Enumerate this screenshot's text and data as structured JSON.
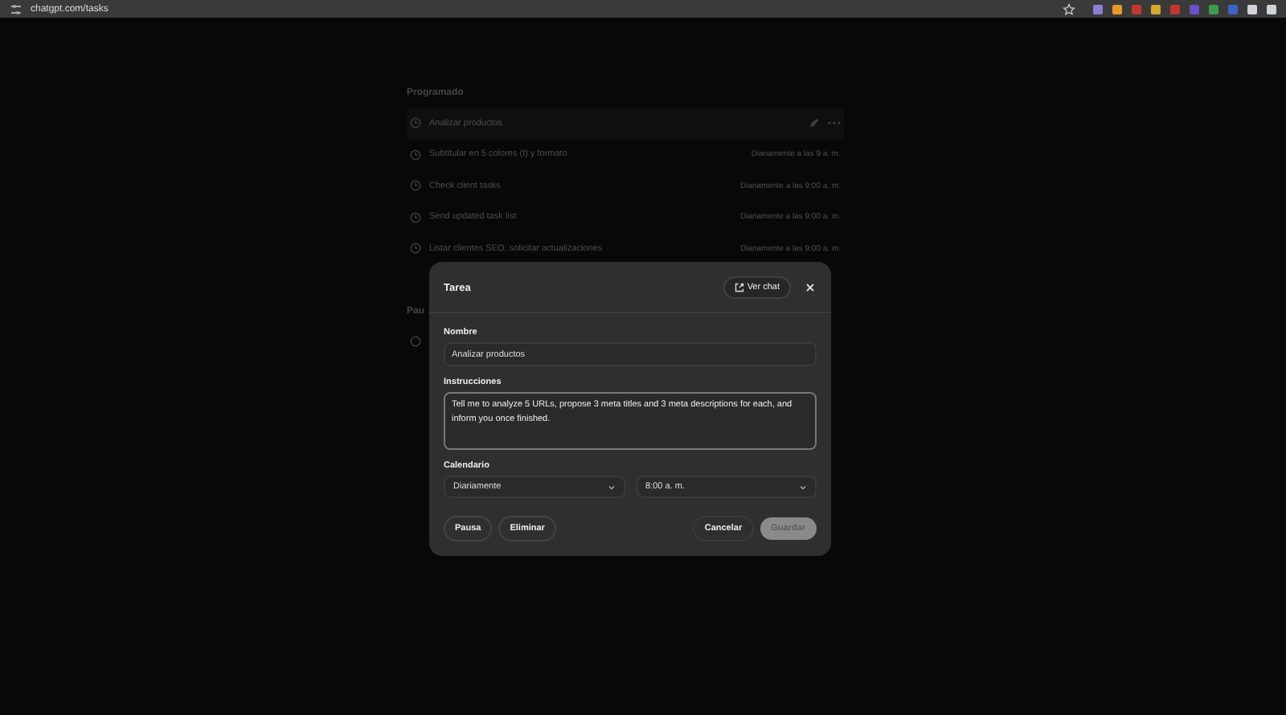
{
  "browser": {
    "url": "chatgpt.com/tasks"
  },
  "background": {
    "section_title": "Programado",
    "tasks": [
      {
        "name": "Analizar productos",
        "hovered": true
      },
      {
        "name": "Subtitular en 5 colores (t) y formato",
        "schedule": "Diariamente a las 9 a. m.",
        "hovered": false
      },
      {
        "name": "Check client tasks",
        "schedule": "Diariamente a las 9:00 a. m.",
        "hovered": false
      },
      {
        "name": "Send updated task list",
        "schedule": "Diariamente a las 9:00 a. m.",
        "hovered": false
      },
      {
        "name": "Listar clientes SEO: solicitar actualizaciones",
        "schedule": "Diariamente a las 9:00 a. m.",
        "hovered": false
      }
    ],
    "section2_title": "Pau"
  },
  "dialog": {
    "title": "Tarea",
    "view_chat": "Ver chat",
    "name_label": "Nombre",
    "name_value": "Analizar productos",
    "instructions_label": "Instrucciones",
    "instructions_value": "Tell me to analyze 5 URLs, propose 3 meta titles and 3 meta descriptions for each, and inform you once finished.",
    "schedule_label": "Calendario",
    "frequency": "Diariamente",
    "time": "8:00 a. m.",
    "buttons": [
      {
        "label": "Pausa",
        "kind": "outline"
      },
      {
        "label": "Eliminar",
        "kind": "outline"
      },
      {
        "label": "Cancelar",
        "kind": "plain"
      },
      {
        "label": "Guardar",
        "kind": "primary",
        "disabled": true
      }
    ]
  }
}
